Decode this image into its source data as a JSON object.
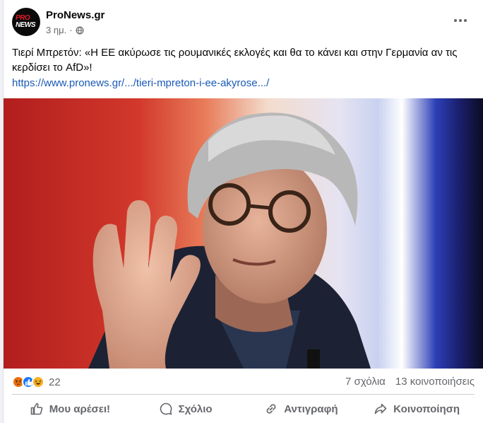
{
  "post": {
    "page_name": "ProNews.gr",
    "avatar_text_line1": "PRO",
    "avatar_text_line2": "NEWS",
    "time": "3 ημ.",
    "separator": "·",
    "audience_icon": "globe-icon",
    "text": "Τιερί Μπρετόν: «Η ΕΕ ακύρωσε τις ρουμανικές εκλογές και θα το κάνει και στην Γερμανία αν τις κερδίσει το AfD»!",
    "link": "https://www.pronews.gr/.../tieri-mpreton-i-ee-akyrose.../"
  },
  "reactions": {
    "icons": [
      "angry-icon",
      "like-icon",
      "haha-icon"
    ],
    "count": "22",
    "comments": "7 σχόλια",
    "shares": "13 κοινοποιήσεις"
  },
  "actions": {
    "like": "Μου αρέσει!",
    "comment": "Σχόλιο",
    "copy": "Αντιγραφή",
    "share": "Κοινοποίηση"
  },
  "colors": {
    "link": "#1a5ab5",
    "secondary_text": "#65676b",
    "like_blue": "#1877f2",
    "angry_orange": "#e9710f",
    "haha_yellow": "#f7b125"
  }
}
